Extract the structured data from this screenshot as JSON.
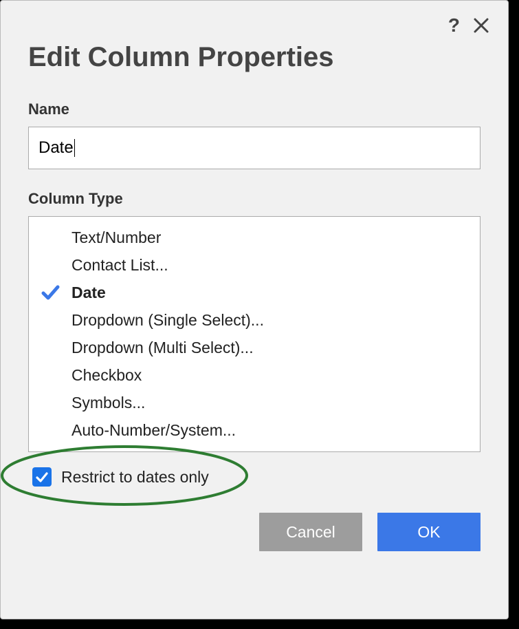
{
  "dialog": {
    "title": "Edit Column Properties",
    "name_label": "Name",
    "name_value": "Date",
    "column_type_label": "Column Type",
    "types": [
      {
        "label": "Text/Number",
        "selected": false
      },
      {
        "label": "Contact List...",
        "selected": false
      },
      {
        "label": "Date",
        "selected": true
      },
      {
        "label": "Dropdown (Single Select)...",
        "selected": false
      },
      {
        "label": "Dropdown (Multi Select)...",
        "selected": false
      },
      {
        "label": "Checkbox",
        "selected": false
      },
      {
        "label": "Symbols...",
        "selected": false
      },
      {
        "label": "Auto-Number/System...",
        "selected": false
      }
    ],
    "restrict_label": "Restrict to dates only",
    "restrict_checked": true,
    "cancel_label": "Cancel",
    "ok_label": "OK"
  }
}
